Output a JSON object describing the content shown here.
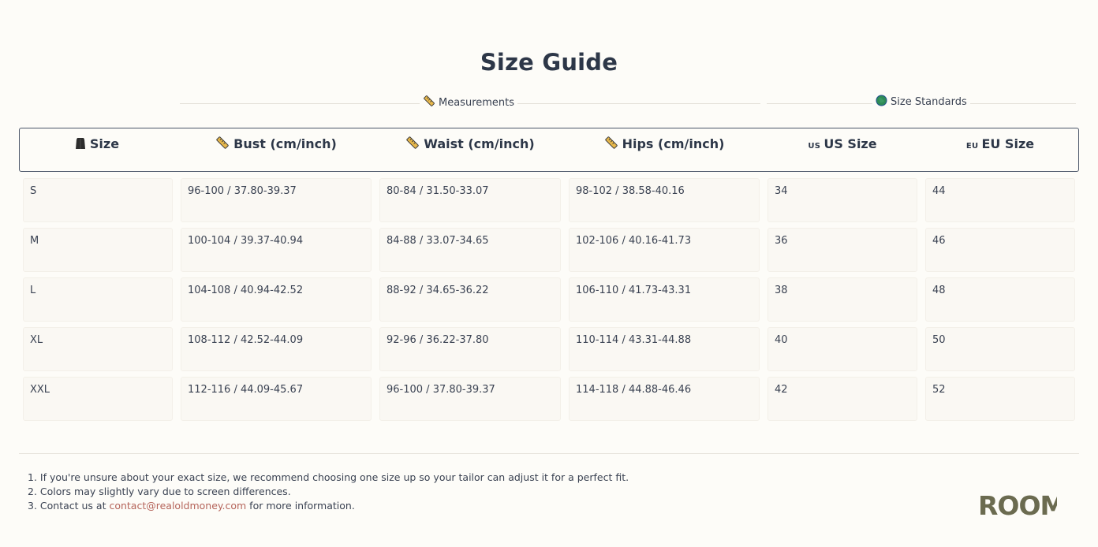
{
  "title": "Size Guide",
  "groups": {
    "measurements": {
      "label": "Measurements",
      "icon": "ruler-icon"
    },
    "standards": {
      "label": "Size Standards",
      "icon": "globe-icon"
    }
  },
  "columns": [
    {
      "label": "Size",
      "icon": "clothing-icon"
    },
    {
      "label": "Bust (cm/inch)",
      "icon": "ruler-icon"
    },
    {
      "label": "Waist (cm/inch)",
      "icon": "ruler-icon"
    },
    {
      "label": "Hips (cm/inch)",
      "icon": "ruler-icon"
    },
    {
      "label": "US Size",
      "flag": "US"
    },
    {
      "label": "EU Size",
      "flag": "EU"
    }
  ],
  "rows": [
    [
      "S",
      "96-100 / 37.80-39.37",
      "80-84 / 31.50-33.07",
      "98-102 / 38.58-40.16",
      "34",
      "44"
    ],
    [
      "M",
      "100-104 / 39.37-40.94",
      "84-88 / 33.07-34.65",
      "102-106 / 40.16-41.73",
      "36",
      "46"
    ],
    [
      "L",
      "104-108 / 40.94-42.52",
      "88-92 / 34.65-36.22",
      "106-110 / 41.73-43.31",
      "38",
      "48"
    ],
    [
      "XL",
      "108-112 / 42.52-44.09",
      "92-96 / 36.22-37.80",
      "110-114 / 43.31-44.88",
      "40",
      "50"
    ],
    [
      "XXL",
      "112-116 / 44.09-45.67",
      "96-100 / 37.80-39.37",
      "114-118 / 44.88-46.46",
      "42",
      "52"
    ]
  ],
  "notes": {
    "n1": "1. If you're unsure about your exact size, we recommend choosing one size up so your tailor can adjust it for a perfect fit.",
    "n2": "2. Colors may slightly vary due to screen differences.",
    "n3_prefix": "3. Contact us at ",
    "n3_email": "contact@realoldmoney.com",
    "n3_suffix": " for more information."
  },
  "logo": {
    "text": "ROOM",
    "color": "#6b6b50"
  },
  "colors": {
    "accent_link": "#b5645a",
    "text": "#2d3748",
    "ruler": "#e8b84a",
    "globe": "#2e8b57"
  }
}
